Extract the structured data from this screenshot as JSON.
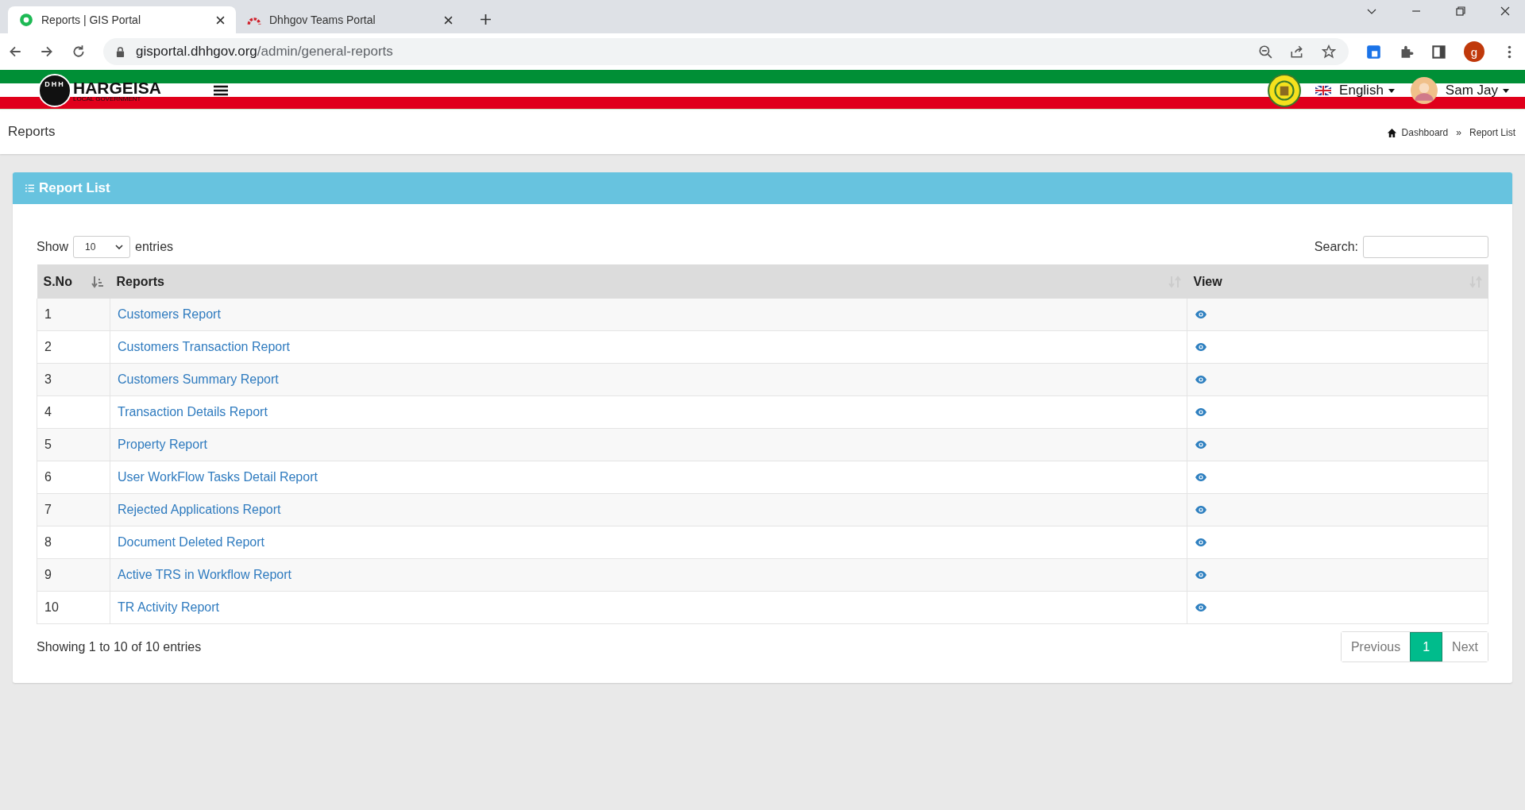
{
  "browser": {
    "tabs": [
      {
        "title": "Reports | GIS Portal",
        "selected": true,
        "kind": "gis"
      },
      {
        "title": "Dhhgov Teams Portal",
        "selected": false,
        "kind": "teams"
      }
    ],
    "url_host": "gisportal.dhhgov.org",
    "url_path": "/admin/general-reports",
    "profile_initial": "g"
  },
  "header": {
    "logo_mark": "DHH",
    "logo_title": "HARGEISA",
    "logo_subtitle": "LOCAL GOVERNMENT",
    "language": "English",
    "user": "Sam Jay"
  },
  "page": {
    "title": "Reports",
    "breadcrumb": [
      "Dashboard",
      "Report List"
    ],
    "separator": "»"
  },
  "card": {
    "title": "Report List",
    "show_label": "Show",
    "page_size": "10",
    "entries_label": "entries",
    "search_label": "Search:",
    "table": {
      "columns": [
        "S.No",
        "Reports",
        "View"
      ],
      "rows": [
        {
          "no": "1",
          "report": "Customers Report"
        },
        {
          "no": "2",
          "report": "Customers Transaction Report"
        },
        {
          "no": "3",
          "report": "Customers Summary Report"
        },
        {
          "no": "4",
          "report": "Transaction Details Report"
        },
        {
          "no": "5",
          "report": "Property Report"
        },
        {
          "no": "6",
          "report": "User WorkFlow Tasks Detail Report"
        },
        {
          "no": "7",
          "report": "Rejected Applications Report"
        },
        {
          "no": "8",
          "report": "Document Deleted Report"
        },
        {
          "no": "9",
          "report": "Active TRS in Workflow Report"
        },
        {
          "no": "10",
          "report": "TR Activity Report"
        }
      ]
    },
    "info": "Showing 1 to 10 of 10 entries",
    "pagination": [
      {
        "label": "Previous",
        "selected": false
      },
      {
        "label": "1",
        "selected": true
      },
      {
        "label": "Next",
        "selected": false
      }
    ]
  }
}
